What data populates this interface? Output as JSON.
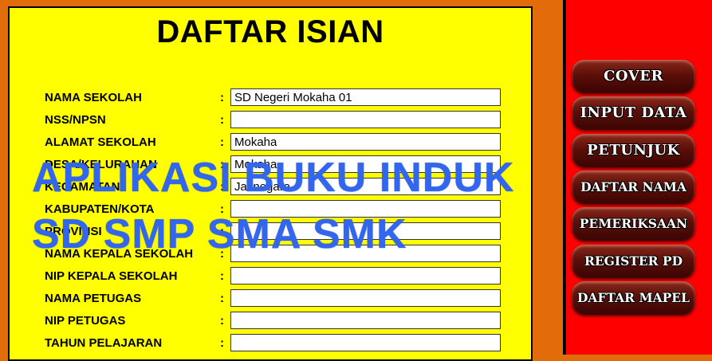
{
  "form": {
    "title": "DAFTAR ISIAN",
    "rows": [
      {
        "label": "NAMA SEKOLAH",
        "colon": ":",
        "value": "SD Negeri Mokaha 01"
      },
      {
        "label": "NSS/NPSN",
        "colon": ":",
        "value": ""
      },
      {
        "label": "ALAMAT SEKOLAH",
        "colon": ":",
        "value": "Mokaha"
      },
      {
        "label": "DESA/KELURAHAN",
        "colon": ":",
        "value": "Mokaha"
      },
      {
        "label": "KECAMATAN",
        "colon": ":",
        "value": "Jatinegara"
      },
      {
        "label": "KABUPATEN/KOTA",
        "colon": ":",
        "value": ""
      },
      {
        "label": "PROVINSI",
        "colon": ":",
        "value": ""
      },
      {
        "label": "NAMA KEPALA SEKOLAH",
        "colon": ":",
        "value": ""
      },
      {
        "label": "NIP KEPALA SEKOLAH",
        "colon": ":",
        "value": ""
      },
      {
        "label": "NAMA PETUGAS",
        "colon": ":",
        "value": ""
      },
      {
        "label": "NIP PETUGAS",
        "colon": ":",
        "value": ""
      },
      {
        "label": "TAHUN PELAJARAN",
        "colon": ":",
        "value": ""
      }
    ]
  },
  "nav": {
    "buttons": [
      "COVER",
      "INPUT DATA",
      "PETUNJUK",
      "DAFTAR NAMA",
      "PEMERIKSAAN",
      "REGISTER PD",
      "DAFTAR MAPEL"
    ]
  },
  "watermark": {
    "line1": "APLIKASI BUKU INDUK",
    "line2": "SD SMP SMA SMK"
  },
  "colors": {
    "background": "#e26b0a",
    "form_panel": "#ffff00",
    "side_panel": "#ff0000",
    "button": "#5c0f08",
    "watermark": "#3366ee"
  }
}
